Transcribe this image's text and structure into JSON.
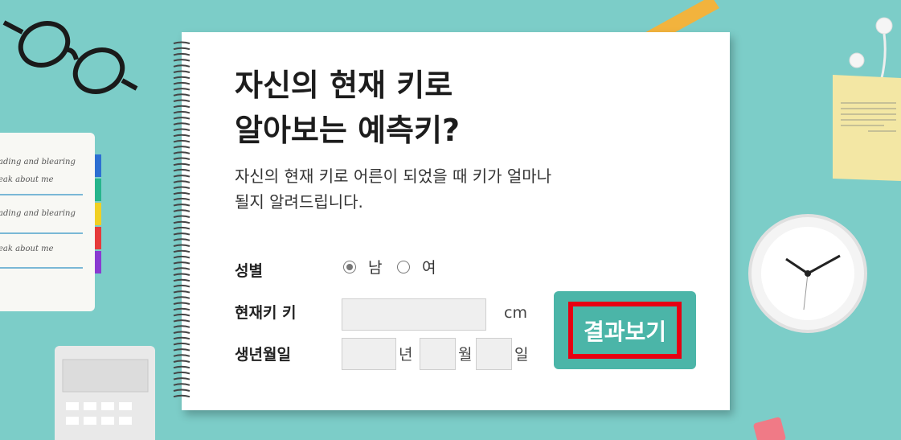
{
  "title": "자신의 현재 키로\n알아보는 예측키?",
  "description": "자신의 현재 키로 어른이 되었을 때 키가 얼마나\n될지 알려드립니다.",
  "form": {
    "gender_label": "성별",
    "gender_options": [
      {
        "label": "남",
        "checked": true
      },
      {
        "label": "여",
        "checked": false
      }
    ],
    "height_label": "현재키 키",
    "height_value": "",
    "height_unit": "cm",
    "birth_label": "생년월일",
    "year_unit": "년",
    "month_unit": "월",
    "day_unit": "일",
    "year_value": "",
    "month_value": "",
    "day_value": ""
  },
  "result_button": "결과보기",
  "colors": {
    "background": "#7ccdc8",
    "button_bg": "#4bb5a8",
    "highlight_border": "#e60012"
  },
  "decor": {
    "notebook_lines": [
      "ading and blearing",
      "eak about me",
      "ading and blearing",
      "eak about me"
    ]
  }
}
